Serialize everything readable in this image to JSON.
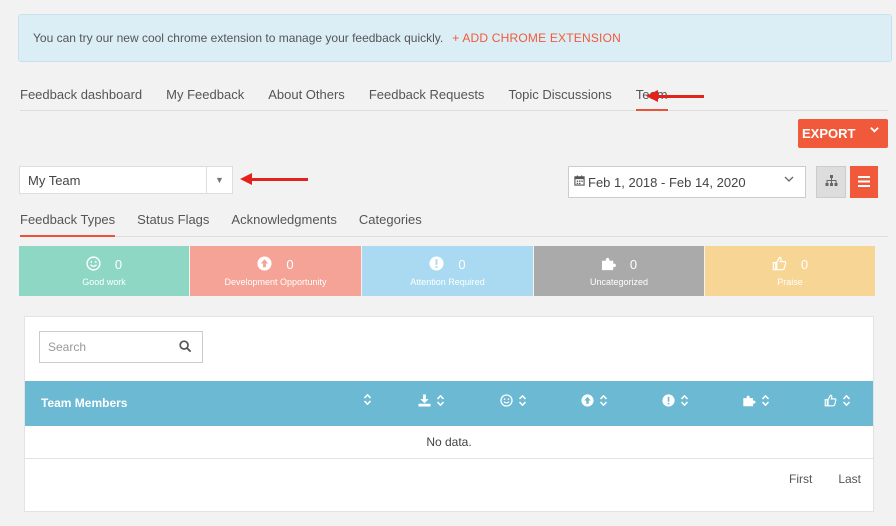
{
  "banner": {
    "text": "You can try our new cool chrome extension to manage your feedback quickly.",
    "link": "+ ADD CHROME EXTENSION"
  },
  "tabs": [
    {
      "label": "Feedback dashboard"
    },
    {
      "label": "My Feedback"
    },
    {
      "label": "About Others"
    },
    {
      "label": "Feedback Requests"
    },
    {
      "label": "Topic Discussions"
    },
    {
      "label": "Team",
      "active": true
    }
  ],
  "export": {
    "label": "EXPORT"
  },
  "team_select": {
    "value": "My Team"
  },
  "date_range": {
    "value": "Feb 1, 2018 - Feb 14, 2020"
  },
  "subtabs": [
    {
      "label": "Feedback Types",
      "active": true
    },
    {
      "label": "Status Flags"
    },
    {
      "label": "Acknowledgments"
    },
    {
      "label": "Categories"
    }
  ],
  "cards": [
    {
      "icon": "smile-icon",
      "count": "0",
      "label": "Good work",
      "color": "#8ed7c4"
    },
    {
      "icon": "arrow-up-circle-icon",
      "count": "0",
      "label": "Development Opportunity",
      "color": "#f4a396"
    },
    {
      "icon": "exclamation-circle-icon",
      "count": "0",
      "label": "Attention Required",
      "color": "#a9daf1"
    },
    {
      "icon": "puzzle-icon",
      "count": "0",
      "label": "Uncategorized",
      "color": "#aaaaaa"
    },
    {
      "icon": "thumbs-up-icon",
      "count": "0",
      "label": "Praise",
      "color": "#f7d594"
    }
  ],
  "search": {
    "placeholder": "Search"
  },
  "table": {
    "header": "Team Members",
    "columns": [
      "sort-icon",
      "download-icon",
      "smile-icon",
      "arrow-up-circle-icon",
      "exclamation-circle-icon",
      "puzzle-icon",
      "thumbs-up-icon"
    ],
    "empty": "No data."
  },
  "pager": {
    "first": "First",
    "last": "Last"
  },
  "colors": {
    "accent": "#f05a3a",
    "table_header": "#6cb9d3",
    "banner_bg": "#dbeef6"
  }
}
